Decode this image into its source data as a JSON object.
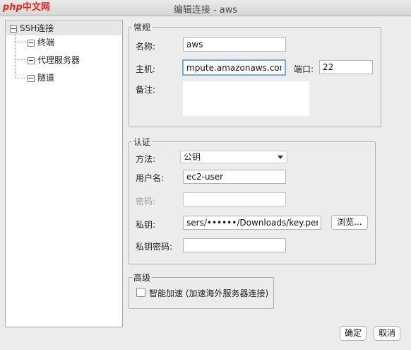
{
  "window": {
    "title": "编辑连接 - aws"
  },
  "logo": {
    "text_php": "php",
    "text_cn": "中文网"
  },
  "tree": {
    "root": "SSH连接",
    "children": [
      "终端",
      "代理服务器",
      "隧道"
    ]
  },
  "general": {
    "legend": "常规",
    "name_label": "名称:",
    "name_value": "aws",
    "host_label": "主机:",
    "host_value": "mpute.amazonaws.com",
    "port_label": "端口:",
    "port_value": "22",
    "note_label": "备注:"
  },
  "auth": {
    "legend": "认证",
    "method_label": "方法:",
    "method_value": "公钥",
    "user_label": "用户名:",
    "user_value": "ec2-user",
    "password_label": "密码:",
    "key_label": "私钥:",
    "key_value": "sers/••••••/Downloads/key.pem",
    "browse_label": "浏览...",
    "key_password_label": "私钥密码:"
  },
  "advanced": {
    "legend": "高级",
    "accel_label": "智能加速 (加速海外服务器连接)"
  },
  "footer": {
    "ok_label": "确定",
    "cancel_label": "取消"
  }
}
